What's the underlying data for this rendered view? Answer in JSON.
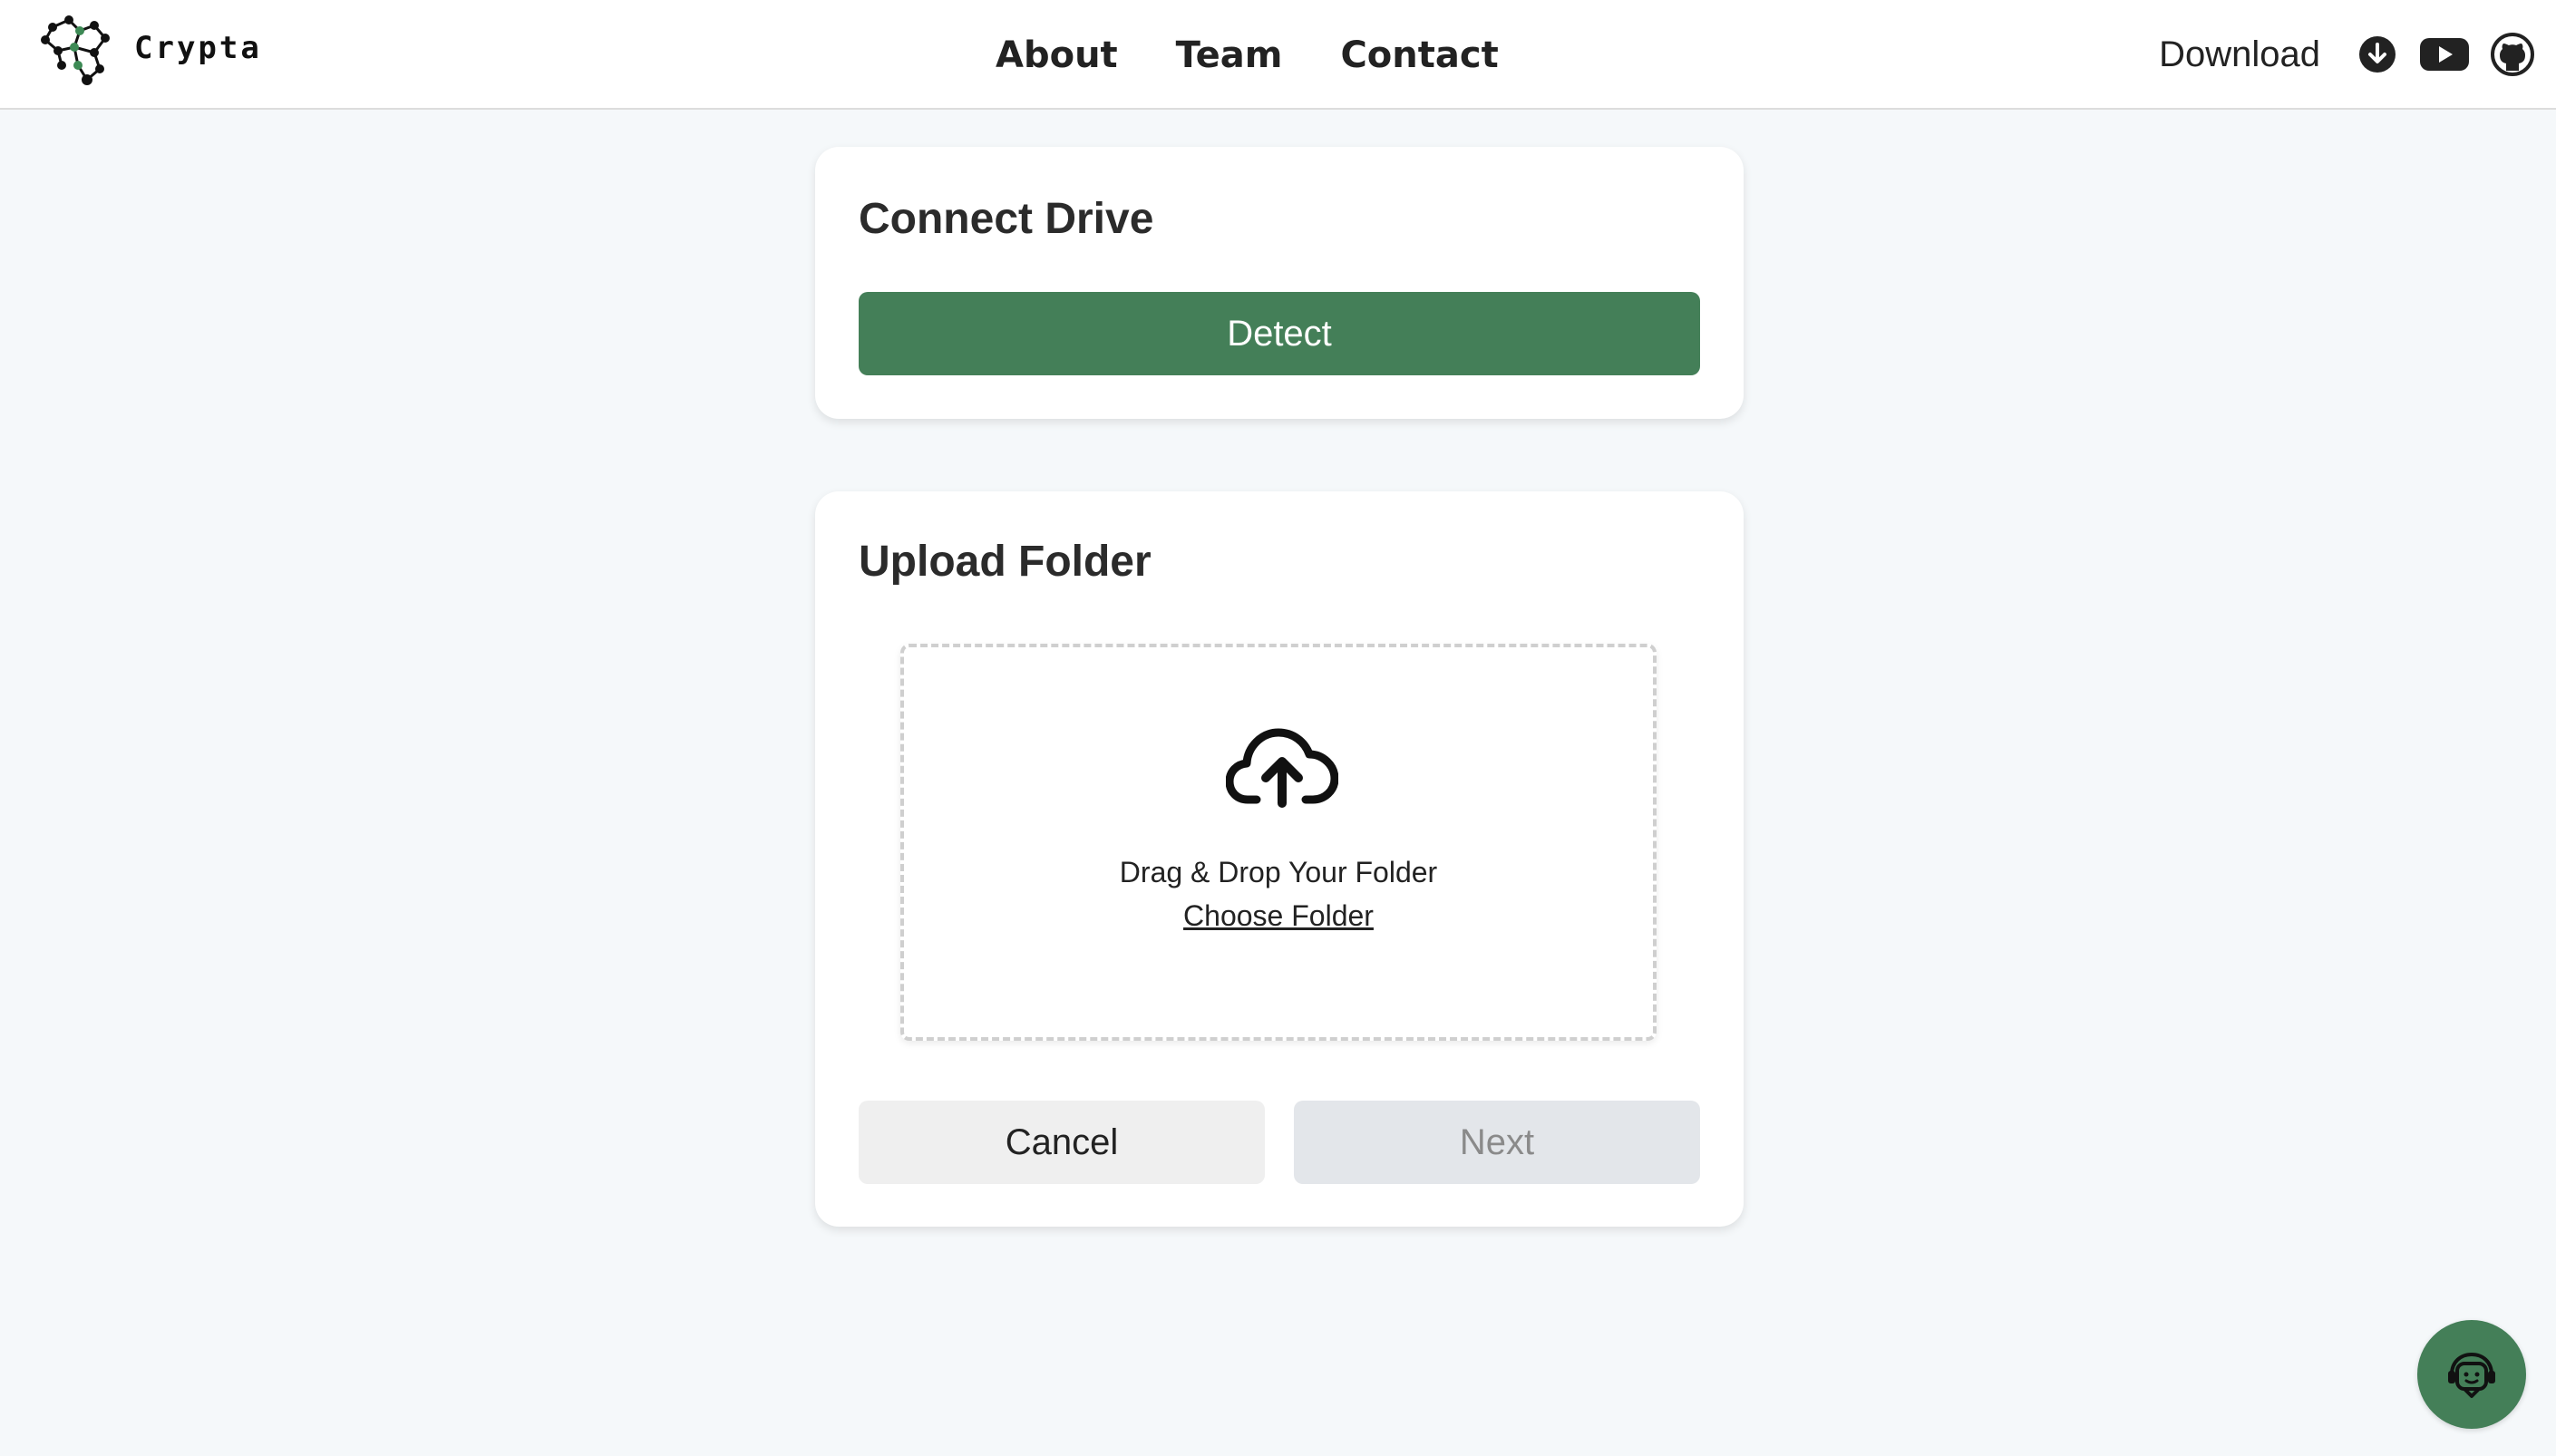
{
  "brand": {
    "name": "Crypta",
    "logo_icon": "network-nodes-logo"
  },
  "nav": {
    "items": [
      {
        "label": "About"
      },
      {
        "label": "Team"
      },
      {
        "label": "Contact"
      }
    ]
  },
  "header_right": {
    "download_label": "Download",
    "icons": [
      "download-circle-icon",
      "youtube-icon",
      "github-icon"
    ]
  },
  "connect_drive": {
    "title": "Connect Drive",
    "detect_label": "Detect"
  },
  "upload_folder": {
    "title": "Upload Folder",
    "drop_text": "Drag & Drop Your Folder",
    "choose_label": "Choose Folder",
    "upload_icon": "cloud-upload-icon",
    "cancel_label": "Cancel",
    "next_label": "Next"
  },
  "chat": {
    "icon": "support-agent-icon"
  },
  "colors": {
    "accent": "#447f58",
    "background": "#f5f8fa",
    "card": "#ffffff"
  }
}
